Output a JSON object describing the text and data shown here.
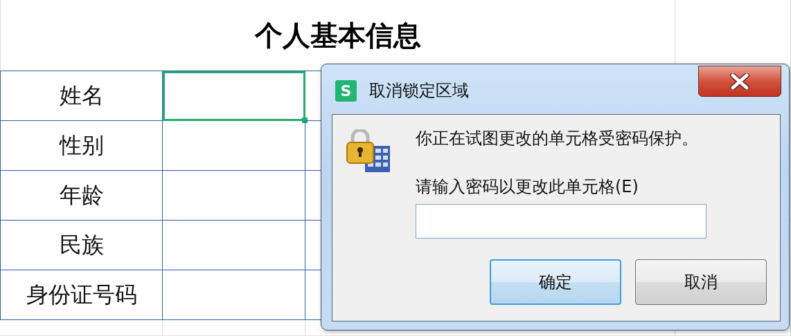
{
  "sheet": {
    "title": "个人基本信息",
    "rows": [
      {
        "label": "姓名",
        "selected": true
      },
      {
        "label": "性别",
        "selected": false
      },
      {
        "label": "年龄",
        "selected": false
      },
      {
        "label": "民族",
        "selected": false
      },
      {
        "label": "身份证号码",
        "selected": false
      }
    ]
  },
  "dialog": {
    "app_icon": "S",
    "title": "取消锁定区域",
    "message": "你正在试图更改的单元格受密码保护。",
    "prompt": "请输入密码以更改此单元格(E)",
    "buttons": [
      {
        "label": "确定",
        "focused": true
      },
      {
        "label": "取消",
        "focused": false
      }
    ]
  }
}
